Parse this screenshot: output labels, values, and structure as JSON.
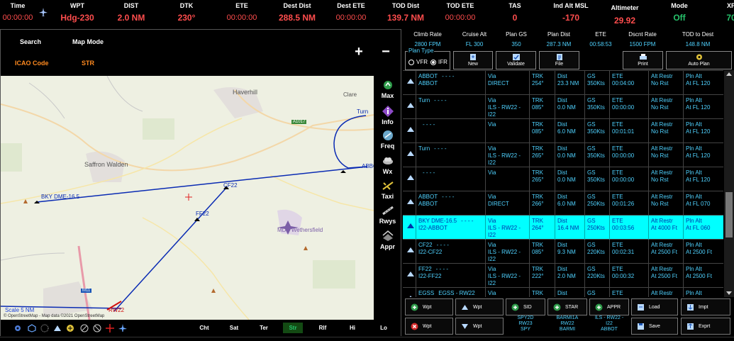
{
  "topbar": {
    "time": {
      "label": "Time",
      "value": "00:00:00"
    },
    "wpt": {
      "label": "WPT",
      "value": "Hdg-230"
    },
    "dist": {
      "label": "DIST",
      "value": "2.0 NM"
    },
    "dtk": {
      "label": "DTK",
      "value": "230°"
    },
    "ete": {
      "label": "ETE",
      "value": "00:00:00"
    },
    "dest_dist": {
      "label": "Dest Dist",
      "value": "288.5 NM"
    },
    "dest_ete": {
      "label": "Dest ETE",
      "value": "00:00:00"
    },
    "tod_dist": {
      "label": "TOD Dist",
      "value": "139.7 NM"
    },
    "tod_ete": {
      "label": "TOD ETE",
      "value": "00:00:00"
    },
    "tas": {
      "label": "TAS",
      "value": "0"
    },
    "ind_alt": {
      "label": "Ind Alt MSL",
      "value": "-170"
    },
    "altimeter": {
      "label": "Altimeter",
      "value": "29.92"
    },
    "mode": {
      "label": "Mode",
      "value": "Off"
    },
    "xp": {
      "label": "XP",
      "value": "70"
    }
  },
  "map_panel": {
    "search_label": "Search",
    "map_mode_label": "Map Mode",
    "icao_label": "ICAO Code",
    "icao_value": "STR",
    "tools": [
      "Max",
      "Info",
      "Freq",
      "Wx",
      "Taxi",
      "Rwys",
      "Appr"
    ],
    "map_types": [
      "Cht",
      "Sat",
      "Ter",
      "Str",
      "Rlf",
      "Hi",
      "Lo"
    ],
    "active_map_type": "Str",
    "scale": "Scale 5 NM",
    "attribution": "© OpenStreetMap - Map data ©2021 OpenStreetMap",
    "places": [
      "Haverhill",
      "Clare",
      "Saffron Walden",
      "MDP Wethersfield"
    ],
    "roads": [
      "A1017",
      "M11"
    ],
    "waypoints": [
      "Turn",
      "ABBOT",
      "CF22",
      "FF22",
      "BKY DME-16.5",
      "RW22"
    ]
  },
  "plan_header": {
    "climb_rate": {
      "label": "Climb Rate",
      "value": "2800 FPM"
    },
    "cruise_alt": {
      "label": "Cruise Alt",
      "value": "FL 300"
    },
    "plan_gs": {
      "label": "Plan GS",
      "value": "350"
    },
    "plan_dist": {
      "label": "Plan Dist",
      "value": "287.3 NM"
    },
    "ete": {
      "label": "ETE",
      "value": "00:58:53"
    },
    "descent_rate": {
      "label": "Dscnt Rate",
      "value": "1500 FPM"
    },
    "tod_to_dest": {
      "label": "TOD to Dest",
      "value": "148.8 NM"
    }
  },
  "plan_type": {
    "title": "Plan Type",
    "options": [
      "VFR",
      "IFR"
    ],
    "selected": "IFR"
  },
  "plan_buttons": [
    "New",
    "Validate",
    "File",
    "Print",
    "Auto Plan"
  ],
  "plan_rows": [
    {
      "wpt": "ABBOT",
      "wpt2": "ABBOT",
      "dash": "- - - -",
      "via": "Via",
      "via2": "DIRECT",
      "via3": "",
      "trk": "TRK",
      "trk2": "254°",
      "dist": "Dist",
      "dist2": "23.3 NM",
      "gs": "GS",
      "gs2": "350Kts",
      "ete": "ETE",
      "ete2": "00:04:00",
      "alt": "Alt Restr",
      "alt2": "No Rst",
      "pln": "Pln Alt",
      "pln2": "At FL 120",
      "selected": false
    },
    {
      "wpt": "Turn",
      "wpt2": "",
      "dash": "- - - -",
      "via": "Via",
      "via2": "ILS - RW22 -",
      "via3": "I22",
      "trk": "TRK",
      "trk2": "085°",
      "dist": "Dist",
      "dist2": "0.0 NM",
      "gs": "GS",
      "gs2": "350Kts",
      "ete": "ETE",
      "ete2": "00:00:00",
      "alt": "Alt Restr",
      "alt2": "No Rst",
      "pln": "Pln Alt",
      "pln2": "At FL 120",
      "selected": false
    },
    {
      "wpt": "",
      "wpt2": "",
      "dash": "- - - -",
      "via": "Via",
      "via2": "",
      "via3": "",
      "trk": "TRK",
      "trk2": "085°",
      "dist": "Dist",
      "dist2": "6.0 NM",
      "gs": "GS",
      "gs2": "350Kts",
      "ete": "ETE",
      "ete2": "00:01:01",
      "alt": "Alt Restr",
      "alt2": "No Rst",
      "pln": "Pln Alt",
      "pln2": "At FL 120",
      "selected": false
    },
    {
      "wpt": "Turn",
      "wpt2": "",
      "dash": "- - - -",
      "via": "Via",
      "via2": "ILS - RW22 -",
      "via3": "I22",
      "trk": "TRK",
      "trk2": "265°",
      "dist": "Dist",
      "dist2": "0.0 NM",
      "gs": "GS",
      "gs2": "350Kts",
      "ete": "ETE",
      "ete2": "00:00:00",
      "alt": "Alt Restr",
      "alt2": "No Rst",
      "pln": "Pln Alt",
      "pln2": "At FL 120",
      "selected": false
    },
    {
      "wpt": "",
      "wpt2": "",
      "dash": "- - - -",
      "via": "Via",
      "via2": "",
      "via3": "",
      "trk": "TRK",
      "trk2": "265°",
      "dist": "Dist",
      "dist2": "0.0 NM",
      "gs": "GS",
      "gs2": "350Kts",
      "ete": "ETE",
      "ete2": "00:00:00",
      "alt": "Alt Restr",
      "alt2": "No Rst",
      "pln": "Pln Alt",
      "pln2": "At FL 120",
      "selected": false
    },
    {
      "wpt": "ABBOT",
      "wpt2": "ABBOT",
      "dash": "- - - -",
      "via": "Via",
      "via2": "DIRECT",
      "via3": "",
      "trk": "TRK",
      "trk2": "266°",
      "dist": "Dist",
      "dist2": "6.0 NM",
      "gs": "GS",
      "gs2": "250Kts",
      "ete": "ETE",
      "ete2": "00:01:26",
      "alt": "Alt Restr",
      "alt2": "No Rst",
      "pln": "Pln Alt",
      "pln2": "At FL 070",
      "selected": false
    },
    {
      "wpt": "BKY DME-16.5",
      "wpt2": "I22-ABBOT",
      "dash": "- - - -",
      "via": "Via",
      "via2": "ILS - RW22 -",
      "via3": "I22",
      "trk": "TRK",
      "trk2": "264°",
      "dist": "Dist",
      "dist2": "16.4 NM",
      "gs": "GS",
      "gs2": "250Kts",
      "ete": "ETE",
      "ete2": "00:03:56",
      "alt": "Alt Restr",
      "alt2": "At 4000 Ft",
      "pln": "Pln Alt",
      "pln2": "At FL 060",
      "selected": true
    },
    {
      "wpt": "CF22",
      "wpt2": "I22-CF22",
      "dash": "- - - -",
      "via": "Via",
      "via2": "ILS - RW22 -",
      "via3": "I22",
      "trk": "TRK",
      "trk2": "085°",
      "dist": "Dist",
      "dist2": "9.3 NM",
      "gs": "GS",
      "gs2": "220Kts",
      "ete": "ETE",
      "ete2": "00:02:31",
      "alt": "Alt Restr",
      "alt2": "At 2500 Ft",
      "pln": "Pln Alt",
      "pln2": "At 2500 Ft",
      "selected": false
    },
    {
      "wpt": "FF22",
      "wpt2": "I22-FF22",
      "dash": "- - - -",
      "via": "Via",
      "via2": "ILS - RW22 -",
      "via3": "I22",
      "trk": "TRK",
      "trk2": "222°",
      "dist": "Dist",
      "dist2": "2.0 NM",
      "gs": "GS",
      "gs2": "220Kts",
      "ete": "ETE",
      "ete2": "00:00:32",
      "alt": "Alt Restr",
      "alt2": "At 2500 Ft",
      "pln": "Pln Alt",
      "pln2": "At 2500 Ft",
      "selected": false
    },
    {
      "wpt": "EGSS",
      "wpt2": "",
      "dash": "EGSS - RW22",
      "via": "Via",
      "via2": "ILS - RW22 -",
      "via3": "",
      "trk": "TRK",
      "trk2": "",
      "dist": "Dist",
      "dist2": "",
      "gs": "GS",
      "gs2": "",
      "ete": "ETE",
      "ete2": "",
      "alt": "Alt Restr",
      "alt2": "",
      "pln": "Pln Alt",
      "pln2": "",
      "selected": false
    }
  ],
  "bottom_buttons": {
    "add_wpt": "Wpt",
    "up_wpt": "Wpt",
    "sid": "SID",
    "star": "STAR",
    "appr": "APPR",
    "load": "Load",
    "impt": "Impt",
    "del_wpt": "Wpt",
    "down_wpt": "Wpt",
    "save": "Save",
    "exprt": "Exprt"
  },
  "procedures": {
    "sid": [
      "SPY2D",
      "RW23",
      "SPY"
    ],
    "star": [
      "BARMI1A",
      "RW22",
      "BARMI"
    ],
    "appr": [
      "ILS - RW22 -",
      "I22",
      "ABBOT"
    ]
  },
  "colors": {
    "accent_red": "#ff4d4d",
    "accent_cyan": "#4fd2ff",
    "accent_green": "#26c26b",
    "selected_row": "#00ffff",
    "route": "#0a2bb3"
  }
}
